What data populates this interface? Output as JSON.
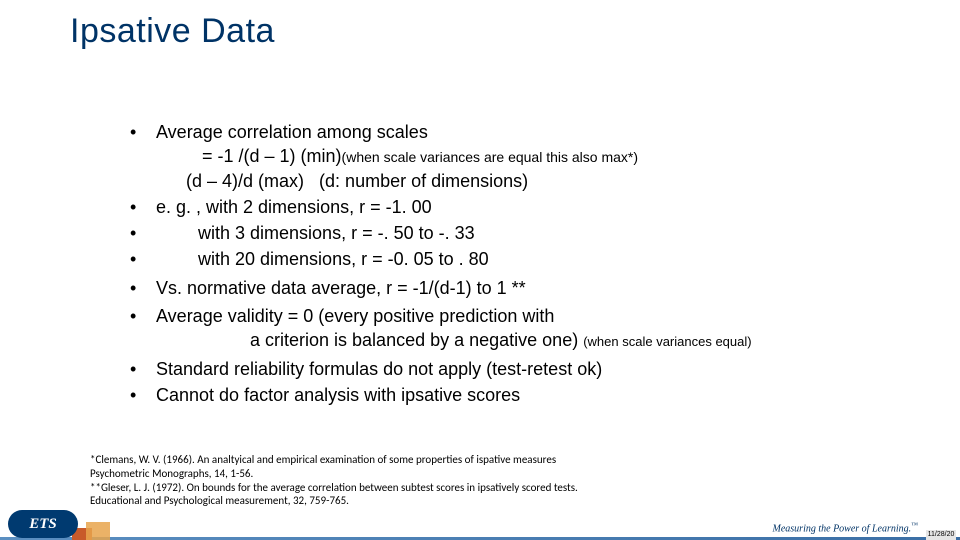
{
  "title": "Ipsative Data",
  "bullets": {
    "b1": "Average correlation among scales",
    "b1_line2_a": "= -1 /(d – 1) (min)",
    "b1_line2_b": "(when scale variances are equal this also max*)",
    "b1_line3_a": "(d – 4)/d (max)",
    "b1_line3_b": "(d: number of dimensions)",
    "b2": "e. g. , with 2 dimensions, r = -1. 00",
    "b3": "with 3 dimensions, r = -. 50 to -. 33",
    "b4": "with 20 dimensions, r = -0. 05  to . 80",
    "b5": "Vs. normative data average, r = -1/(d-1) to 1 **",
    "b6_a": "Average validity = 0 (every positive prediction with",
    "b6_b": "a criterion is balanced by a negative one)",
    "b6_note": "(when scale variances equal)",
    "b7": "Standard reliability formulas do not apply (test-retest ok)",
    "b8": "Cannot do factor analysis with ipsative scores"
  },
  "refs": {
    "r1": "*Clemans, W. V. (1966). An analtyical and empirical examination of some properties of ispative measures",
    "r2": "Psychometric Monographs, 14, 1-56.",
    "r3": "**Gleser, L. J. (1972). On bounds for the average correlation between subtest scores in ipsatively scored tests.",
    "r4": "Educational and Psychological measurement, 32, 759-765."
  },
  "brand": {
    "logo": "ETS",
    "tagline": "Measuring the Power of Learning.",
    "tm": "™"
  },
  "date_stub": "11/28/20"
}
